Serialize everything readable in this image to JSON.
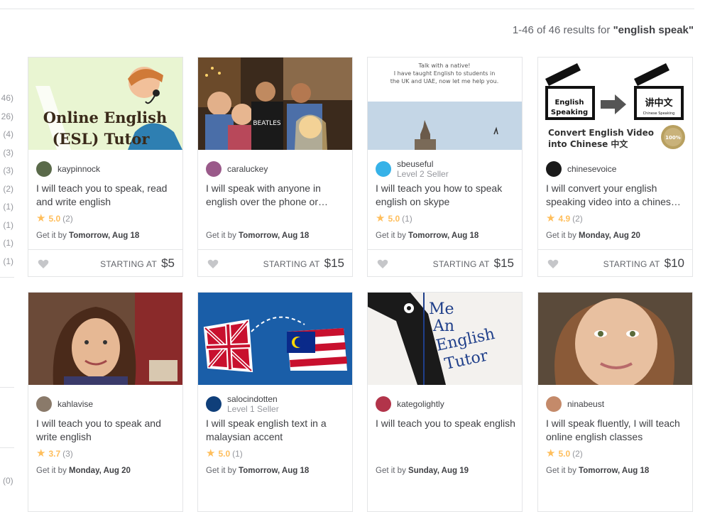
{
  "results": {
    "range": "1-46 of 46 results for",
    "query": "\"english speak\""
  },
  "sidebar": {
    "counts": [
      "46)",
      "26)",
      "(4)",
      "(3)",
      "(3)",
      "(2)",
      "(1)",
      "(1)",
      "(1)",
      "(1)"
    ],
    "bottom_count": "(0)"
  },
  "colors": {
    "star": "#ffbe5b",
    "border": "#e4e5e7",
    "text": "#404145",
    "muted": "#95979d"
  },
  "cards": [
    {
      "seller": "kaypinnock",
      "level": "",
      "title": "I will teach you to speak, read and write english",
      "score": "5.0",
      "reviews": "(2)",
      "delivery_prefix": "Get it by",
      "delivery_date": "Tomorrow, Aug 18",
      "starting_label": "STARTING AT",
      "price": "$5",
      "thumb": {
        "line1": "Online English",
        "line2": "(ESL) Tutor"
      }
    },
    {
      "seller": "caraluckey",
      "level": "",
      "title": "I will speak with anyone in english over the phone or…",
      "score": "",
      "reviews": "",
      "delivery_prefix": "Get it by",
      "delivery_date": "Tomorrow, Aug 18",
      "starting_label": "STARTING AT",
      "price": "$15",
      "thumb": {
        "shirt_text": "BEATLES"
      }
    },
    {
      "seller": "sbeuseful",
      "level": "Level 2 Seller",
      "title": "I will teach you how to speak english on skype",
      "score": "5.0",
      "reviews": "(1)",
      "delivery_prefix": "Get it by",
      "delivery_date": "Tomorrow, Aug 18",
      "starting_label": "STARTING AT",
      "price": "$15",
      "thumb": {
        "line1": "Talk with a native!",
        "line2": "I have taught English to students in",
        "line3": "the UK and UAE, now let me help you."
      }
    },
    {
      "seller": "chinesevoice",
      "level": "",
      "title": "I will convert your english speaking video into a chines…",
      "score": "4.9",
      "reviews": "(2)",
      "delivery_prefix": "Get it by",
      "delivery_date": "Monday, Aug 20",
      "starting_label": "STARTING AT",
      "price": "$10",
      "thumb": {
        "left_board": "English Speaking",
        "right_board": "讲中文",
        "right_sub": "Chinese Speaking",
        "caption1": "Convert English Video",
        "caption2": "into Chinese 中文",
        "badge": "100%"
      }
    },
    {
      "seller": "kahlavise",
      "level": "",
      "title": "I will teach you to speak and write english",
      "score": "3.7",
      "reviews": "(3)",
      "delivery_prefix": "Get it by",
      "delivery_date": "Monday, Aug 20",
      "starting_label": "",
      "price": "",
      "thumb": {}
    },
    {
      "seller": "salocindotten",
      "level": "Level 1 Seller",
      "title": "I will speak english text in a malaysian accent",
      "score": "5.0",
      "reviews": "(1)",
      "delivery_prefix": "Get it by",
      "delivery_date": "Tomorrow, Aug 18",
      "starting_label": "",
      "price": "",
      "thumb": {}
    },
    {
      "seller": "kategolightly",
      "level": "",
      "title": "I will teach you to speak english",
      "score": "",
      "reviews": "",
      "delivery_prefix": "Get it by",
      "delivery_date": "Sunday, Aug 19",
      "starting_label": "",
      "price": "",
      "thumb": {
        "w1": "Me",
        "w2": "An",
        "w3": "English",
        "w4": "Tutor"
      }
    },
    {
      "seller": "ninabeust",
      "level": "",
      "title": "I will speak fluently, I will teach online english classes",
      "score": "5.0",
      "reviews": "(2)",
      "delivery_prefix": "Get it by",
      "delivery_date": "Tomorrow, Aug 18",
      "starting_label": "",
      "price": "",
      "thumb": {}
    }
  ]
}
